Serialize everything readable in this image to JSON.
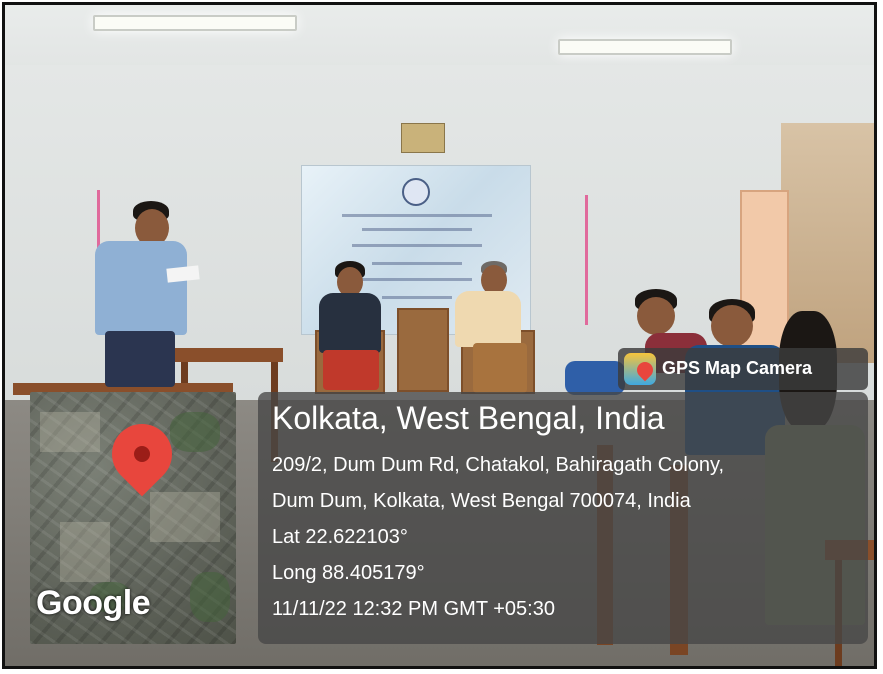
{
  "overlay": {
    "app_badge": "GPS Map Camera",
    "app_icon": "gps-map-camera-icon",
    "location_title": "Kolkata, West Bengal, India",
    "address_line_1": "209/2, Dum Dum Rd, Chatakol, Bahiragath Colony,",
    "address_line_2": "Dum Dum, Kolkata, West Bengal 700074, India",
    "latitude": "Lat 22.622103°",
    "longitude": "Long 88.405179°",
    "timestamp": "11/11/22 12:32 PM GMT +05:30"
  },
  "map": {
    "brand": "Google",
    "marker_icon": "location-pin-icon",
    "marker_color": "#e8463d"
  }
}
